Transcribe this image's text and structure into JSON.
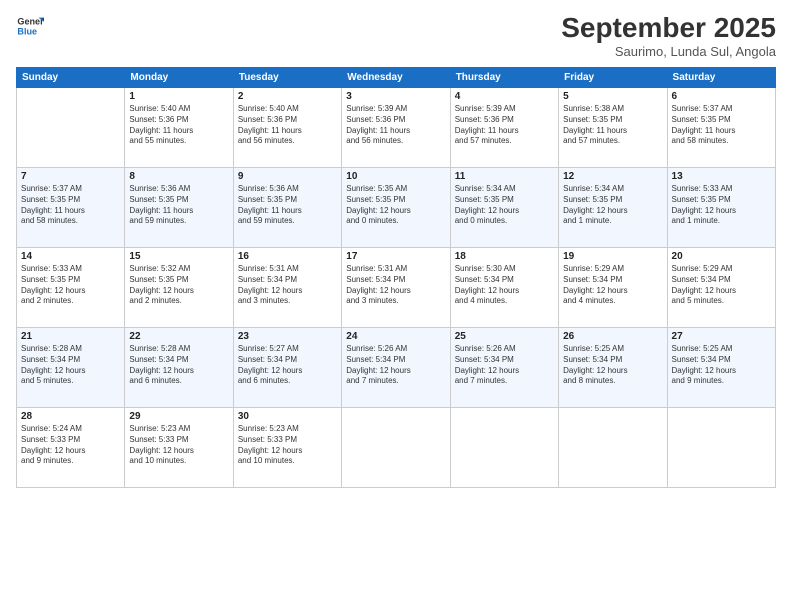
{
  "logo": {
    "line1": "General",
    "line2": "Blue"
  },
  "title": "September 2025",
  "subtitle": "Saurimo, Lunda Sul, Angola",
  "days_of_week": [
    "Sunday",
    "Monday",
    "Tuesday",
    "Wednesday",
    "Thursday",
    "Friday",
    "Saturday"
  ],
  "weeks": [
    [
      {
        "day": "",
        "info": ""
      },
      {
        "day": "1",
        "info": "Sunrise: 5:40 AM\nSunset: 5:36 PM\nDaylight: 11 hours\nand 55 minutes."
      },
      {
        "day": "2",
        "info": "Sunrise: 5:40 AM\nSunset: 5:36 PM\nDaylight: 11 hours\nand 56 minutes."
      },
      {
        "day": "3",
        "info": "Sunrise: 5:39 AM\nSunset: 5:36 PM\nDaylight: 11 hours\nand 56 minutes."
      },
      {
        "day": "4",
        "info": "Sunrise: 5:39 AM\nSunset: 5:36 PM\nDaylight: 11 hours\nand 57 minutes."
      },
      {
        "day": "5",
        "info": "Sunrise: 5:38 AM\nSunset: 5:35 PM\nDaylight: 11 hours\nand 57 minutes."
      },
      {
        "day": "6",
        "info": "Sunrise: 5:37 AM\nSunset: 5:35 PM\nDaylight: 11 hours\nand 58 minutes."
      }
    ],
    [
      {
        "day": "7",
        "info": "Sunrise: 5:37 AM\nSunset: 5:35 PM\nDaylight: 11 hours\nand 58 minutes."
      },
      {
        "day": "8",
        "info": "Sunrise: 5:36 AM\nSunset: 5:35 PM\nDaylight: 11 hours\nand 59 minutes."
      },
      {
        "day": "9",
        "info": "Sunrise: 5:36 AM\nSunset: 5:35 PM\nDaylight: 11 hours\nand 59 minutes."
      },
      {
        "day": "10",
        "info": "Sunrise: 5:35 AM\nSunset: 5:35 PM\nDaylight: 12 hours\nand 0 minutes."
      },
      {
        "day": "11",
        "info": "Sunrise: 5:34 AM\nSunset: 5:35 PM\nDaylight: 12 hours\nand 0 minutes."
      },
      {
        "day": "12",
        "info": "Sunrise: 5:34 AM\nSunset: 5:35 PM\nDaylight: 12 hours\nand 1 minute."
      },
      {
        "day": "13",
        "info": "Sunrise: 5:33 AM\nSunset: 5:35 PM\nDaylight: 12 hours\nand 1 minute."
      }
    ],
    [
      {
        "day": "14",
        "info": "Sunrise: 5:33 AM\nSunset: 5:35 PM\nDaylight: 12 hours\nand 2 minutes."
      },
      {
        "day": "15",
        "info": "Sunrise: 5:32 AM\nSunset: 5:35 PM\nDaylight: 12 hours\nand 2 minutes."
      },
      {
        "day": "16",
        "info": "Sunrise: 5:31 AM\nSunset: 5:34 PM\nDaylight: 12 hours\nand 3 minutes."
      },
      {
        "day": "17",
        "info": "Sunrise: 5:31 AM\nSunset: 5:34 PM\nDaylight: 12 hours\nand 3 minutes."
      },
      {
        "day": "18",
        "info": "Sunrise: 5:30 AM\nSunset: 5:34 PM\nDaylight: 12 hours\nand 4 minutes."
      },
      {
        "day": "19",
        "info": "Sunrise: 5:29 AM\nSunset: 5:34 PM\nDaylight: 12 hours\nand 4 minutes."
      },
      {
        "day": "20",
        "info": "Sunrise: 5:29 AM\nSunset: 5:34 PM\nDaylight: 12 hours\nand 5 minutes."
      }
    ],
    [
      {
        "day": "21",
        "info": "Sunrise: 5:28 AM\nSunset: 5:34 PM\nDaylight: 12 hours\nand 5 minutes."
      },
      {
        "day": "22",
        "info": "Sunrise: 5:28 AM\nSunset: 5:34 PM\nDaylight: 12 hours\nand 6 minutes."
      },
      {
        "day": "23",
        "info": "Sunrise: 5:27 AM\nSunset: 5:34 PM\nDaylight: 12 hours\nand 6 minutes."
      },
      {
        "day": "24",
        "info": "Sunrise: 5:26 AM\nSunset: 5:34 PM\nDaylight: 12 hours\nand 7 minutes."
      },
      {
        "day": "25",
        "info": "Sunrise: 5:26 AM\nSunset: 5:34 PM\nDaylight: 12 hours\nand 7 minutes."
      },
      {
        "day": "26",
        "info": "Sunrise: 5:25 AM\nSunset: 5:34 PM\nDaylight: 12 hours\nand 8 minutes."
      },
      {
        "day": "27",
        "info": "Sunrise: 5:25 AM\nSunset: 5:34 PM\nDaylight: 12 hours\nand 9 minutes."
      }
    ],
    [
      {
        "day": "28",
        "info": "Sunrise: 5:24 AM\nSunset: 5:33 PM\nDaylight: 12 hours\nand 9 minutes."
      },
      {
        "day": "29",
        "info": "Sunrise: 5:23 AM\nSunset: 5:33 PM\nDaylight: 12 hours\nand 10 minutes."
      },
      {
        "day": "30",
        "info": "Sunrise: 5:23 AM\nSunset: 5:33 PM\nDaylight: 12 hours\nand 10 minutes."
      },
      {
        "day": "",
        "info": ""
      },
      {
        "day": "",
        "info": ""
      },
      {
        "day": "",
        "info": ""
      },
      {
        "day": "",
        "info": ""
      }
    ]
  ]
}
